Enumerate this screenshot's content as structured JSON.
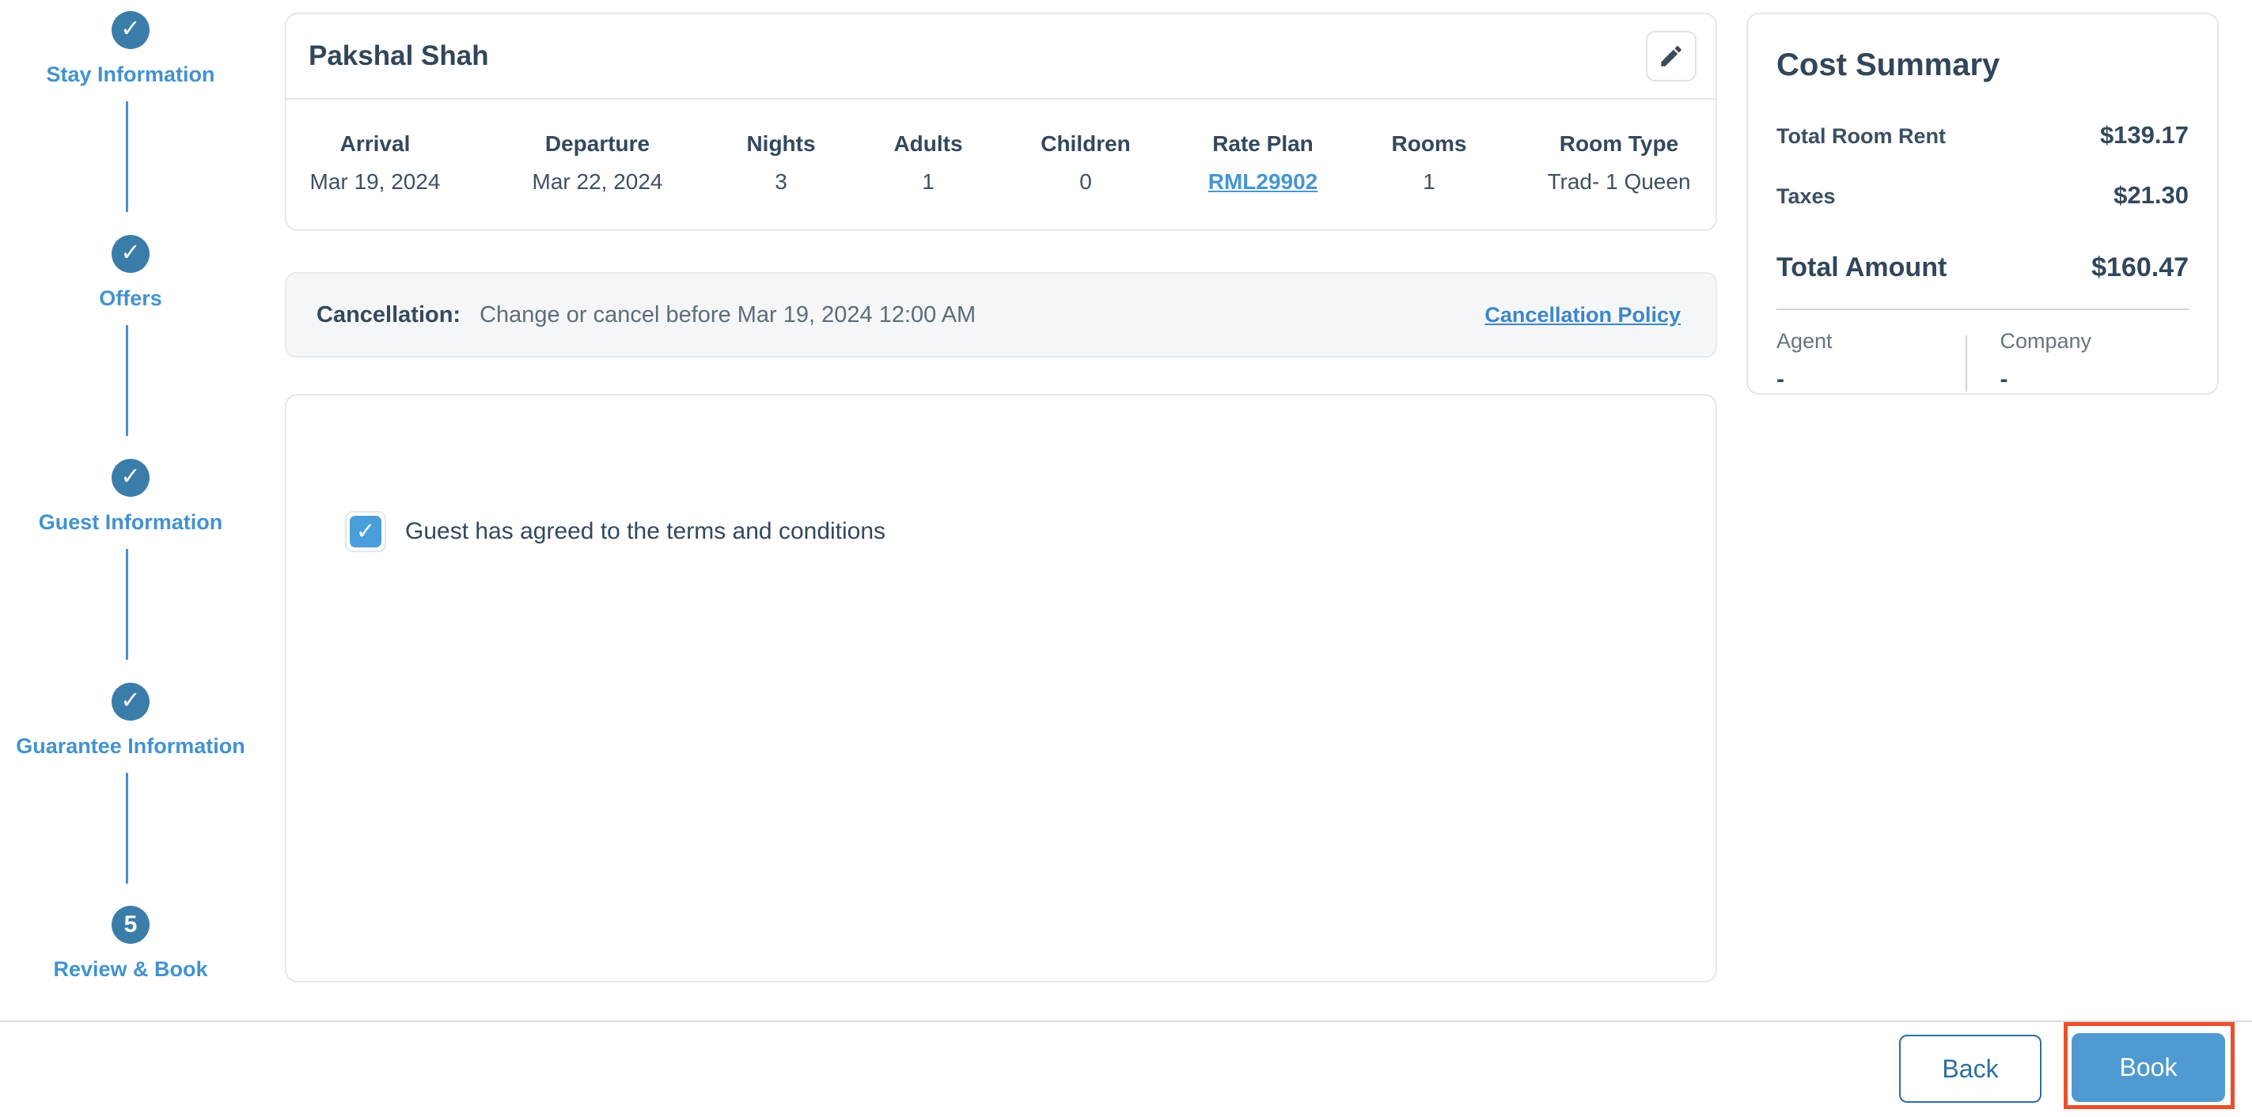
{
  "icons": {
    "check": "✓",
    "edit": "✎"
  },
  "colors": {
    "step_circle_blue": "#3b7da9",
    "step_label_blue": "#4392cf",
    "dark_text": "#32465a",
    "muted_text": "#5e6c7a",
    "link_blue": "#3d87c8",
    "rate_plan_link_blue": "#4596d3",
    "checkbox_blue": "#4a9ed9",
    "book_button_blue": "#4f9ad0",
    "back_button_blue": "#2e6f9f",
    "highlight_red": "#e8502c",
    "cancellation_bar_bg": "#f5f6f7",
    "card_border": "#e4e7ea"
  },
  "stepper": {
    "steps": [
      {
        "label": "Stay Information",
        "state": "completed"
      },
      {
        "label": "Offers",
        "state": "completed"
      },
      {
        "label": "Guest Information",
        "state": "completed"
      },
      {
        "label": "Guarantee Information",
        "state": "completed"
      },
      {
        "label": "Review & Book",
        "state": "active",
        "number": "5"
      }
    ]
  },
  "stay": {
    "guest_name": "Pakshal Shah",
    "fields": [
      {
        "label": "Arrival",
        "value": "Mar 19, 2024"
      },
      {
        "label": "Departure",
        "value": "Mar 22, 2024"
      },
      {
        "label": "Nights",
        "value": "3"
      },
      {
        "label": "Adults",
        "value": "1"
      },
      {
        "label": "Children",
        "value": "0"
      },
      {
        "label": "Rate Plan",
        "value": "RML29902"
      },
      {
        "label": "Rooms",
        "value": "1"
      },
      {
        "label": "Room Type",
        "value": "Trad- 1 Queen"
      }
    ]
  },
  "cancellation": {
    "label": "Cancellation:",
    "text": "Change or cancel before Mar 19, 2024 12:00 AM",
    "policy_link": "Cancellation Policy"
  },
  "terms": {
    "checkbox_label": "Guest has agreed to the terms and conditions",
    "checked": true
  },
  "cost_summary": {
    "title": "Cost Summary",
    "rows": [
      {
        "label": "Total Room Rent",
        "value": "$139.17"
      },
      {
        "label": "Taxes",
        "value": "$21.30"
      }
    ],
    "total": {
      "label": "Total Amount",
      "value": "$160.47"
    },
    "agent": {
      "label": "Agent",
      "value": "-"
    },
    "company": {
      "label": "Company",
      "value": "-"
    }
  },
  "footer": {
    "back_label": "Back",
    "book_label": "Book"
  }
}
